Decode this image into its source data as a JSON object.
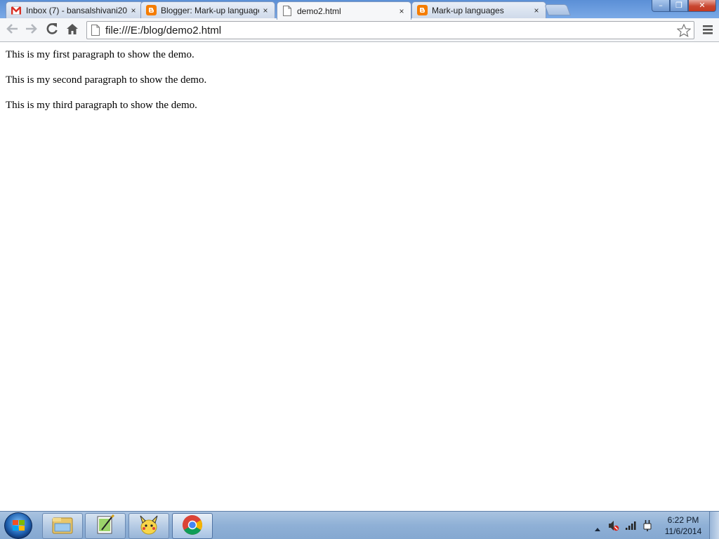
{
  "browser": {
    "tabs": [
      {
        "title": "Inbox (7) - bansalshivani20",
        "icon": "gmail-icon",
        "active": false
      },
      {
        "title": "Blogger: Mark-up language",
        "icon": "blogger-icon",
        "active": false
      },
      {
        "title": "demo2.html",
        "icon": "page-icon",
        "active": true
      },
      {
        "title": "Mark-up languages",
        "icon": "blogger-icon",
        "active": false
      }
    ],
    "tab_close_glyph": "×",
    "address_url": "file:///E:/blog/demo2.html",
    "window_controls": {
      "minimize": "–",
      "maximize": "❐",
      "close": "✕"
    }
  },
  "page": {
    "paragraphs": [
      "This is my first paragraph to show the demo.",
      "This is my second paragraph to show the demo.",
      "This is my third paragraph to show the demo."
    ]
  },
  "taskbar": {
    "apps": [
      "windows-explorer-icon",
      "notepad-plus-plus-icon",
      "pikachu-app-icon",
      "chrome-icon"
    ],
    "clock_time": "6:22 PM",
    "clock_date": "11/6/2014"
  },
  "colors": {
    "titlebar": "#6e9fe0",
    "active_tab": "#f6f7f9",
    "taskbar": "#8fb0d6"
  }
}
